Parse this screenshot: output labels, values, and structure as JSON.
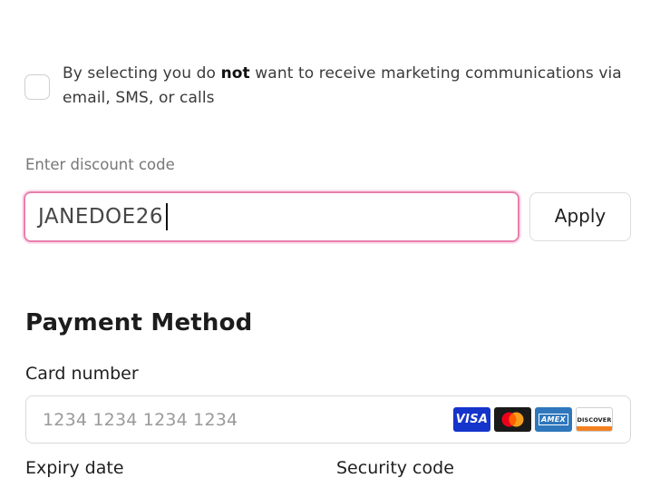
{
  "marketing": {
    "text_before": "By selecting you do ",
    "text_bold": "not",
    "text_after": " want to receive marketing communications via email, SMS, or calls",
    "checked": false
  },
  "discount": {
    "label": "Enter discount code",
    "value": "JANEDOE26",
    "apply_label": "Apply",
    "focus_color": "#e97fae"
  },
  "payment": {
    "title": "Payment Method",
    "card_number_label": "Card number",
    "card_number_placeholder": "1234 1234 1234 1234",
    "card_brands": {
      "visa": "VISA",
      "mastercard": "mastercard-icon",
      "amex": "AMEX",
      "discover": "DISCOVER"
    },
    "expiry_label": "Expiry date",
    "security_label": "Security code"
  }
}
